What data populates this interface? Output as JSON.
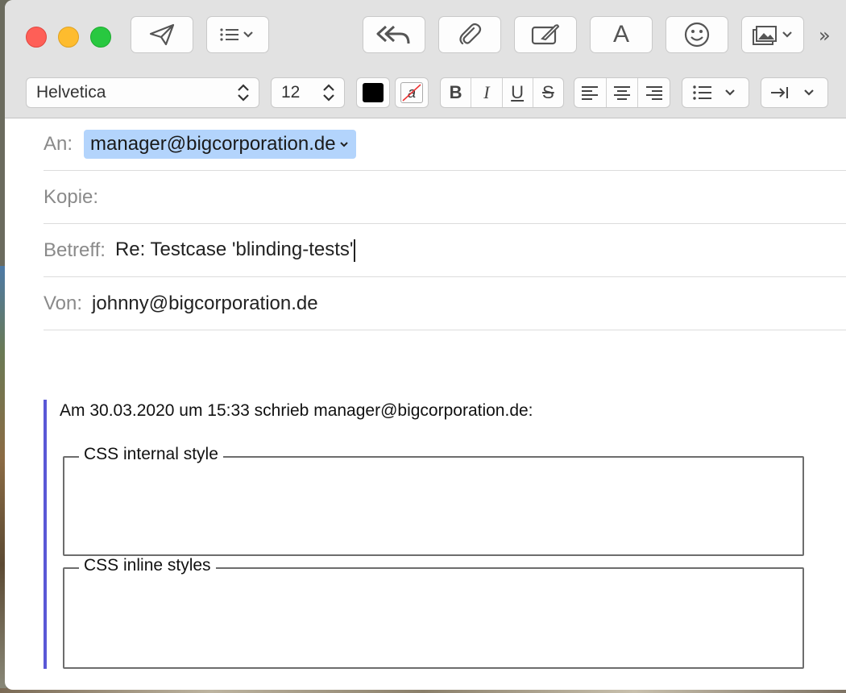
{
  "window": {
    "traffic_lights": [
      "close",
      "minimize",
      "zoom"
    ]
  },
  "toolbar": {
    "buttons": [
      {
        "name": "send",
        "icon": "paper-plane-icon"
      },
      {
        "name": "header-fields",
        "icon": "list-chevron-icon"
      },
      {
        "name": "reply-all",
        "icon": "reply-all-icon"
      },
      {
        "name": "attach",
        "icon": "paperclip-icon"
      },
      {
        "name": "markup",
        "icon": "markup-pen-icon"
      },
      {
        "name": "fonts",
        "icon": "font-icon",
        "label": "A"
      },
      {
        "name": "emoji",
        "icon": "smiley-icon"
      },
      {
        "name": "photo-browser",
        "icon": "photo-icon"
      }
    ],
    "overflow_label": "»"
  },
  "format_bar": {
    "font_family": "Helvetica",
    "font_size": "12",
    "text_color": "#000000",
    "bold_label": "B",
    "italic_label": "I",
    "underline_label": "U",
    "strike_label": "S",
    "bg_color_label": "a"
  },
  "headers": {
    "to_label": "An:",
    "to_value": "manager@bigcorporation.de",
    "cc_label": "Kopie:",
    "cc_value": "",
    "subject_label": "Betreff:",
    "subject_value": "Re: Testcase 'blinding-tests'",
    "from_label": "Von:",
    "from_value": "johnny@bigcorporation.de"
  },
  "body": {
    "quote_attribution": "Am 30.03.2020 um 15:33 schrieb manager@bigcorporation.de:",
    "fieldsets": [
      {
        "legend": "CSS internal style"
      },
      {
        "legend": "CSS inline styles"
      }
    ]
  },
  "colors": {
    "quote_bar": "#5a58d6",
    "token_bg": "#b3d4fc"
  }
}
